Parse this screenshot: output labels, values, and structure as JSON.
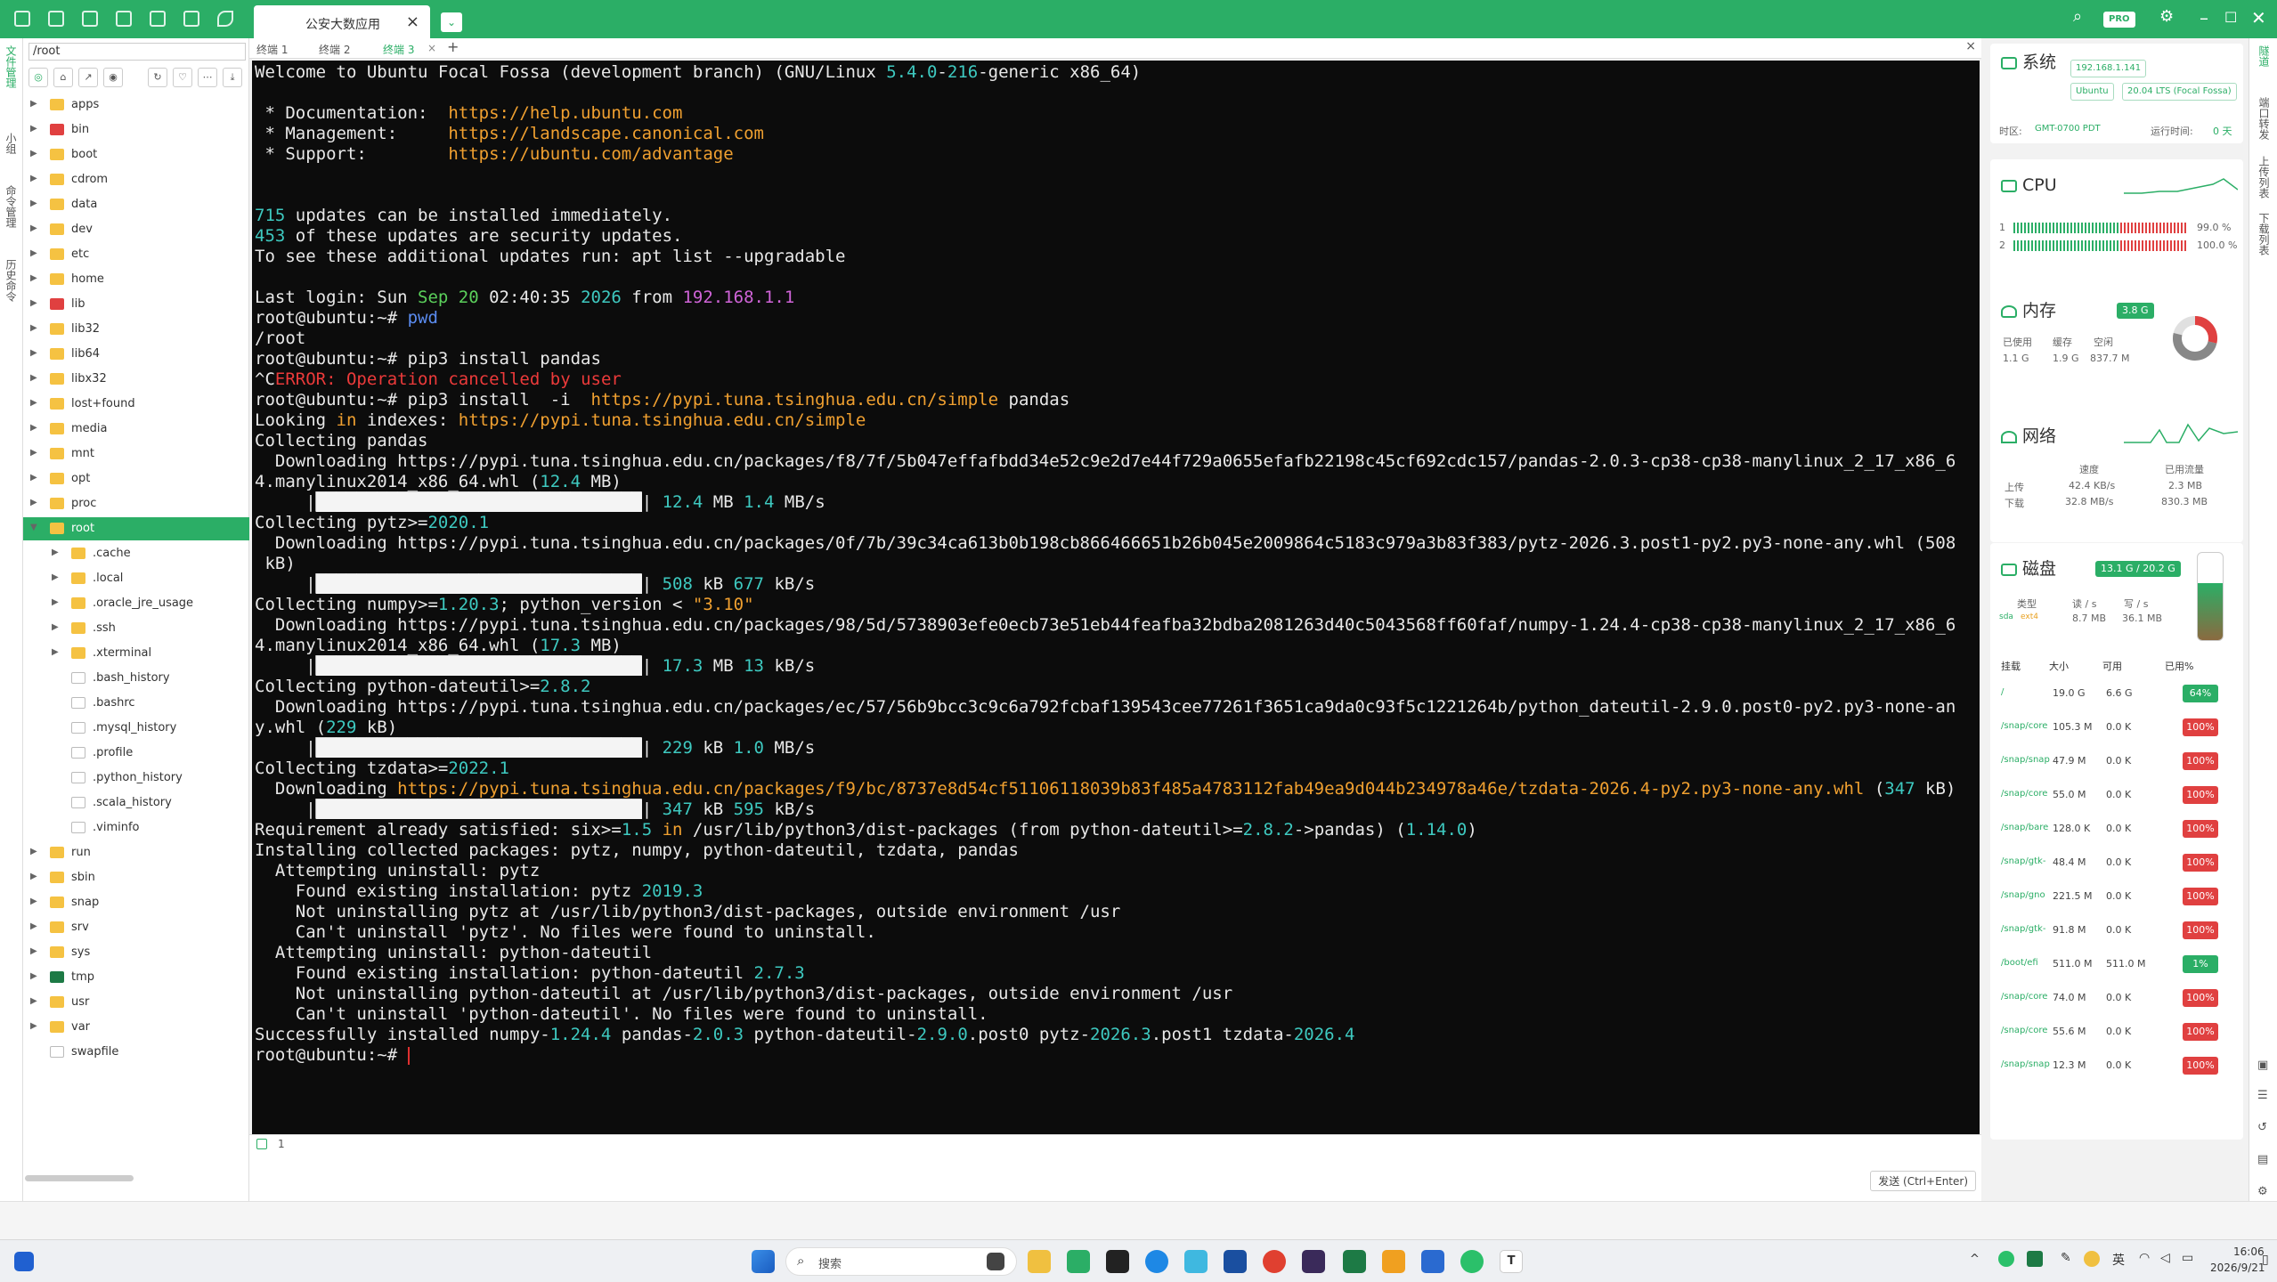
{
  "header": {
    "session_tab": "公安大数应用"
  },
  "left_rail": [
    "文件管理",
    "小组",
    "命令管理",
    "历史命令"
  ],
  "file_panel": {
    "path": "/root",
    "tree": [
      {
        "name": "apps",
        "type": "folder",
        "depth": 0,
        "exp": false
      },
      {
        "name": "bin",
        "type": "folder-red",
        "depth": 0,
        "exp": false
      },
      {
        "name": "boot",
        "type": "folder",
        "depth": 0,
        "exp": false
      },
      {
        "name": "cdrom",
        "type": "folder",
        "depth": 0,
        "exp": false
      },
      {
        "name": "data",
        "type": "folder",
        "depth": 0,
        "exp": false
      },
      {
        "name": "dev",
        "type": "folder",
        "depth": 0,
        "exp": false
      },
      {
        "name": "etc",
        "type": "folder",
        "depth": 0,
        "exp": false
      },
      {
        "name": "home",
        "type": "folder",
        "depth": 0,
        "exp": false
      },
      {
        "name": "lib",
        "type": "folder-red",
        "depth": 0,
        "exp": false
      },
      {
        "name": "lib32",
        "type": "folder",
        "depth": 0,
        "exp": false
      },
      {
        "name": "lib64",
        "type": "folder",
        "depth": 0,
        "exp": false
      },
      {
        "name": "libx32",
        "type": "folder",
        "depth": 0,
        "exp": false
      },
      {
        "name": "lost+found",
        "type": "folder",
        "depth": 0,
        "exp": false
      },
      {
        "name": "media",
        "type": "folder",
        "depth": 0,
        "exp": false
      },
      {
        "name": "mnt",
        "type": "folder",
        "depth": 0,
        "exp": false
      },
      {
        "name": "opt",
        "type": "folder",
        "depth": 0,
        "exp": false
      },
      {
        "name": "proc",
        "type": "folder",
        "depth": 0,
        "exp": false
      },
      {
        "name": "root",
        "type": "folder",
        "depth": 0,
        "exp": true,
        "selected": true
      },
      {
        "name": ".cache",
        "type": "folder",
        "depth": 1,
        "exp": false
      },
      {
        "name": ".local",
        "type": "folder",
        "depth": 1,
        "exp": false
      },
      {
        "name": ".oracle_jre_usage",
        "type": "folder",
        "depth": 1,
        "exp": false
      },
      {
        "name": ".ssh",
        "type": "folder",
        "depth": 1,
        "exp": false
      },
      {
        "name": ".xterminal",
        "type": "folder",
        "depth": 1,
        "exp": false
      },
      {
        "name": ".bash_history",
        "type": "file",
        "depth": 1
      },
      {
        "name": ".bashrc",
        "type": "file",
        "depth": 1
      },
      {
        "name": ".mysql_history",
        "type": "file",
        "depth": 1
      },
      {
        "name": ".profile",
        "type": "file",
        "depth": 1
      },
      {
        "name": ".python_history",
        "type": "file",
        "depth": 1
      },
      {
        "name": ".scala_history",
        "type": "file",
        "depth": 1
      },
      {
        "name": ".viminfo",
        "type": "file",
        "depth": 1
      },
      {
        "name": "run",
        "type": "folder",
        "depth": 0,
        "exp": false
      },
      {
        "name": "sbin",
        "type": "folder",
        "depth": 0,
        "exp": false
      },
      {
        "name": "snap",
        "type": "folder",
        "depth": 0,
        "exp": false
      },
      {
        "name": "srv",
        "type": "folder",
        "depth": 0,
        "exp": false
      },
      {
        "name": "sys",
        "type": "folder",
        "depth": 0,
        "exp": false
      },
      {
        "name": "tmp",
        "type": "folder-green",
        "depth": 0,
        "exp": false
      },
      {
        "name": "usr",
        "type": "folder",
        "depth": 0,
        "exp": false
      },
      {
        "name": "var",
        "type": "folder",
        "depth": 0,
        "exp": false
      },
      {
        "name": "swapfile",
        "type": "file",
        "depth": 0
      }
    ]
  },
  "term_tabs": [
    "终端 1",
    "终端 2",
    "终端 3"
  ],
  "terminal_lines": [
    [
      [
        "Welcome to Ubuntu Focal Fossa (development branch) (GNU/Linux ",
        ""
      ],
      [
        "5.4.0",
        "c"
      ],
      [
        "-",
        ""
      ],
      [
        "216",
        "c"
      ],
      [
        "-generic x86_64)",
        ""
      ]
    ],
    [],
    [
      [
        " * Documentation:  ",
        ""
      ],
      [
        "https://help.ubuntu.com",
        "y"
      ]
    ],
    [
      [
        " * Management:     ",
        ""
      ],
      [
        "https://landscape.canonical.com",
        "y"
      ]
    ],
    [
      [
        " * Support:        ",
        ""
      ],
      [
        "https://ubuntu.com/advantage",
        "y"
      ]
    ],
    [],
    [],
    [
      [
        "715",
        "c"
      ],
      [
        " updates can be installed immediately.",
        ""
      ]
    ],
    [
      [
        "453",
        "c"
      ],
      [
        " of these updates are security updates.",
        ""
      ]
    ],
    [
      [
        "To see these additional updates run: apt list --upgradable",
        ""
      ]
    ],
    [],
    [
      [
        "Last login: Sun ",
        ""
      ],
      [
        "Sep 20",
        "g"
      ],
      [
        " 02:40:35 ",
        ""
      ],
      [
        "2026",
        "c"
      ],
      [
        " from ",
        ""
      ],
      [
        "192.168.1.1",
        "m"
      ]
    ],
    [
      [
        "root@ubuntu:~# ",
        ""
      ],
      [
        "pwd",
        "b"
      ]
    ],
    [
      [
        "/root",
        ""
      ]
    ],
    [
      [
        "root@ubuntu:~# pip3 install pandas",
        ""
      ]
    ],
    [
      [
        "^C",
        ""
      ],
      [
        "ERROR: Operation cancelled ",
        "r"
      ],
      [
        "by user",
        "r"
      ]
    ],
    [
      [
        "root@ubuntu:~# pip3 install  -i  ",
        ""
      ],
      [
        "https://pypi.tuna.tsinghua.edu.cn/simple",
        "y"
      ],
      [
        " pandas",
        ""
      ]
    ],
    [
      [
        "Looking ",
        ""
      ],
      [
        "in",
        "y"
      ],
      [
        " indexes: ",
        ""
      ],
      [
        "https://pypi.tuna.tsinghua.edu.cn/simple",
        "y"
      ]
    ],
    [
      [
        "Collecting pandas",
        ""
      ]
    ],
    [
      [
        "  Downloading https://pypi.tuna.tsinghua.edu.cn/packages/f8/7f/5b047effafbdd34e52c9e2d7e44f729a0655efafb22198c45cf692cdc157/pandas-2.0.3-cp38-cp38-manylinux_2_17_x86_6",
        ""
      ]
    ],
    [
      [
        "4.manylinux2014_x86_64.whl (",
        ""
      ],
      [
        "12.4",
        "c"
      ],
      [
        " MB)",
        ""
      ]
    ],
    [
      [
        "     |",
        ""
      ],
      [
        "████████████████████████████████",
        "bar"
      ],
      [
        "| ",
        ""
      ],
      [
        "12.4",
        "c"
      ],
      [
        " MB ",
        ""
      ],
      [
        "1.4",
        "c"
      ],
      [
        " MB/s",
        ""
      ]
    ],
    [
      [
        "Collecting pytz>=",
        ""
      ],
      [
        "2020.1",
        "c"
      ]
    ],
    [
      [
        "  Downloading https://pypi.tuna.tsinghua.edu.cn/packages/0f/7b/39c34ca613b0b198cb866466651b26b045e2009864c5183c979a3b83f383/pytz-2026.3.post1-py2.py3-none-any.whl (508",
        ""
      ]
    ],
    [
      [
        " kB)",
        ""
      ]
    ],
    [
      [
        "     |",
        ""
      ],
      [
        "████████████████████████████████",
        "bar"
      ],
      [
        "| ",
        ""
      ],
      [
        "508",
        "c"
      ],
      [
        " kB ",
        ""
      ],
      [
        "677",
        "c"
      ],
      [
        " kB/s",
        ""
      ]
    ],
    [
      [
        "Collecting numpy>=",
        ""
      ],
      [
        "1.20.3",
        "c"
      ],
      [
        "; python_version < ",
        ""
      ],
      [
        "\"3.10\"",
        "y"
      ]
    ],
    [
      [
        "  Downloading https://pypi.tuna.tsinghua.edu.cn/packages/98/5d/5738903efe0ecb73e51eb44feafba32bdba2081263d40c5043568ff60faf/numpy-1.24.4-cp38-cp38-manylinux_2_17_x86_6",
        ""
      ]
    ],
    [
      [
        "4.manylinux2014_x86_64.whl (",
        ""
      ],
      [
        "17.3",
        "c"
      ],
      [
        " MB)",
        ""
      ]
    ],
    [
      [
        "     |",
        ""
      ],
      [
        "████████████████████████████████",
        "bar"
      ],
      [
        "| ",
        ""
      ],
      [
        "17.3",
        "c"
      ],
      [
        " MB ",
        ""
      ],
      [
        "13",
        "c"
      ],
      [
        " kB/s",
        ""
      ]
    ],
    [
      [
        "Collecting python-dateutil>=",
        ""
      ],
      [
        "2.8.2",
        "c"
      ]
    ],
    [
      [
        "  Downloading https://pypi.tuna.tsinghua.edu.cn/packages/ec/57/56b9bcc3c9c6a792fcbaf139543cee77261f3651ca9da0c93f5c1221264b/python_dateutil-2.9.0.post0-py2.py3-none-an",
        ""
      ]
    ],
    [
      [
        "y.whl (",
        ""
      ],
      [
        "229",
        "c"
      ],
      [
        " kB)",
        ""
      ]
    ],
    [
      [
        "     |",
        ""
      ],
      [
        "████████████████████████████████",
        "bar"
      ],
      [
        "| ",
        ""
      ],
      [
        "229",
        "c"
      ],
      [
        " kB ",
        ""
      ],
      [
        "1.0",
        "c"
      ],
      [
        " MB/s",
        ""
      ]
    ],
    [
      [
        "Collecting tzdata>=",
        ""
      ],
      [
        "2022.1",
        "c"
      ]
    ],
    [
      [
        "  Downloading ",
        ""
      ],
      [
        "https://pypi.tuna.tsinghua.edu.cn/packages/f9/bc/8737e8d54cf51106118039b83f485a4783112fab49ea9d044b234978a46e/tzdata-2026.4-py2.py3-none-any.whl",
        "y"
      ],
      [
        " (",
        ""
      ],
      [
        "347",
        "c"
      ],
      [
        " kB)",
        ""
      ]
    ],
    [
      [
        "     |",
        ""
      ],
      [
        "████████████████████████████████",
        "bar"
      ],
      [
        "| ",
        ""
      ],
      [
        "347",
        "c"
      ],
      [
        " kB ",
        ""
      ],
      [
        "595",
        "c"
      ],
      [
        " kB/s",
        ""
      ]
    ],
    [
      [
        "Requirement already satisfied: six>=",
        ""
      ],
      [
        "1.5",
        "c"
      ],
      [
        " ",
        ""
      ],
      [
        "in",
        "y"
      ],
      [
        " /usr/lib/python3/dist-packages (from python-dateutil>=",
        ""
      ],
      [
        "2.8.2",
        "c"
      ],
      [
        "->pandas) (",
        ""
      ],
      [
        "1.14.0",
        "c"
      ],
      [
        ")",
        ""
      ]
    ],
    [
      [
        "Installing collected packages: pytz, numpy, python-dateutil, tzdata, pandas",
        ""
      ]
    ],
    [
      [
        "  Attempting uninstall: pytz",
        ""
      ]
    ],
    [
      [
        "    Found existing installation: pytz ",
        ""
      ],
      [
        "2019.3",
        "c"
      ]
    ],
    [
      [
        "    Not uninstalling pytz at /usr/lib/python3/dist-packages, outside environment /usr",
        ""
      ]
    ],
    [
      [
        "    Can't uninstall 'pytz'. No files were found to uninstall.",
        ""
      ]
    ],
    [
      [
        "  Attempting uninstall: python-dateutil",
        ""
      ]
    ],
    [
      [
        "    Found existing installation: python-dateutil ",
        ""
      ],
      [
        "2.7.3",
        "c"
      ]
    ],
    [
      [
        "    Not uninstalling python-dateutil at /usr/lib/python3/dist-packages, outside environment /usr",
        ""
      ]
    ],
    [
      [
        "    Can't uninstall 'python-dateutil'. No files were found to uninstall.",
        ""
      ]
    ],
    [
      [
        "Successfully installed numpy-",
        ""
      ],
      [
        "1.24.4",
        "c"
      ],
      [
        " pandas-",
        ""
      ],
      [
        "2.0.3",
        "c"
      ],
      [
        " python-dateutil-",
        ""
      ],
      [
        "2.9.0",
        "c"
      ],
      [
        ".post0 pytz-",
        ""
      ],
      [
        "2026.3",
        "c"
      ],
      [
        ".post1 tzdata-",
        ""
      ],
      [
        "2026.4",
        "c"
      ]
    ],
    [
      [
        "root@ubuntu:~# ",
        ""
      ]
    ]
  ],
  "cmd_input": {
    "line_number": "1",
    "send_label": "发送 (Ctrl+Enter)"
  },
  "system": {
    "title": "系统",
    "ip": "192.168.1.141",
    "os": "Ubuntu",
    "version": "20.04 LTS (Focal Fossa)",
    "tz_label": "时区:",
    "tz": "GMT-0700 PDT",
    "uptime_label": "运行时间:",
    "uptime": "0 天"
  },
  "cpu": {
    "title": "CPU",
    "cores": [
      {
        "id": "1",
        "pct": "99.0 %",
        "frac": 0.99
      },
      {
        "id": "2",
        "pct": "100.0 %",
        "frac": 1.0
      }
    ]
  },
  "memory": {
    "title": "内存",
    "total": "3.8 G",
    "used_label": "已使用",
    "used": "1.1 G",
    "cache_label": "缓存",
    "cache": "1.9 G",
    "free_label": "空闲",
    "free": "837.7 M"
  },
  "network": {
    "title": "网络",
    "speed_label": "速度",
    "traffic_label": "已用流量",
    "up_label": "上传",
    "up_speed": "42.4 KB/s",
    "up_total": "2.3 MB",
    "down_label": "下载",
    "down_speed": "32.8 MB/s",
    "down_total": "830.3 MB"
  },
  "disk": {
    "title": "磁盘",
    "total": "13.1 G / 20.2 G",
    "dev": "sda",
    "type_label": "类型",
    "type": "ext4",
    "read_label": "读 / s",
    "read": "8.7 MB",
    "write_label": "写 / s",
    "write": "36.1 MB",
    "headers": [
      "挂载",
      "大小",
      "可用",
      "已用%"
    ],
    "rows": [
      {
        "mount": "/",
        "size": "19.0 G",
        "avail": "6.6 G",
        "pct": "64%",
        "color": "#2bae66"
      },
      {
        "mount": "/snap/core",
        "size": "105.3 M",
        "avail": "0.0 K",
        "pct": "100%",
        "color": "#e04040"
      },
      {
        "mount": "/snap/snap",
        "size": "47.9 M",
        "avail": "0.0 K",
        "pct": "100%",
        "color": "#e04040"
      },
      {
        "mount": "/snap/core",
        "size": "55.0 M",
        "avail": "0.0 K",
        "pct": "100%",
        "color": "#e04040"
      },
      {
        "mount": "/snap/bare",
        "size": "128.0 K",
        "avail": "0.0 K",
        "pct": "100%",
        "color": "#e04040"
      },
      {
        "mount": "/snap/gtk-",
        "size": "48.4 M",
        "avail": "0.0 K",
        "pct": "100%",
        "color": "#e04040"
      },
      {
        "mount": "/snap/gno",
        "size": "221.5 M",
        "avail": "0.0 K",
        "pct": "100%",
        "color": "#e04040"
      },
      {
        "mount": "/snap/gtk-",
        "size": "91.8 M",
        "avail": "0.0 K",
        "pct": "100%",
        "color": "#e04040"
      },
      {
        "mount": "/boot/efi",
        "size": "511.0 M",
        "avail": "511.0 M",
        "pct": "1%",
        "color": "#2bae66"
      },
      {
        "mount": "/snap/core",
        "size": "74.0 M",
        "avail": "0.0 K",
        "pct": "100%",
        "color": "#e04040"
      },
      {
        "mount": "/snap/core",
        "size": "55.6 M",
        "avail": "0.0 K",
        "pct": "100%",
        "color": "#e04040"
      },
      {
        "mount": "/snap/snap",
        "size": "12.3 M",
        "avail": "0.0 K",
        "pct": "100%",
        "color": "#e04040"
      }
    ]
  },
  "right_rail": [
    "隧道",
    "端口转发",
    "上传列表",
    "下载列表"
  ],
  "taskbar": {
    "search_placeholder": "搜索",
    "ime": "英",
    "time": "16:06",
    "date": "2026/9/21"
  },
  "colors": {
    "accent": "#2bae66",
    "terminal_bg": "#0c0c0c",
    "danger": "#e04040"
  }
}
